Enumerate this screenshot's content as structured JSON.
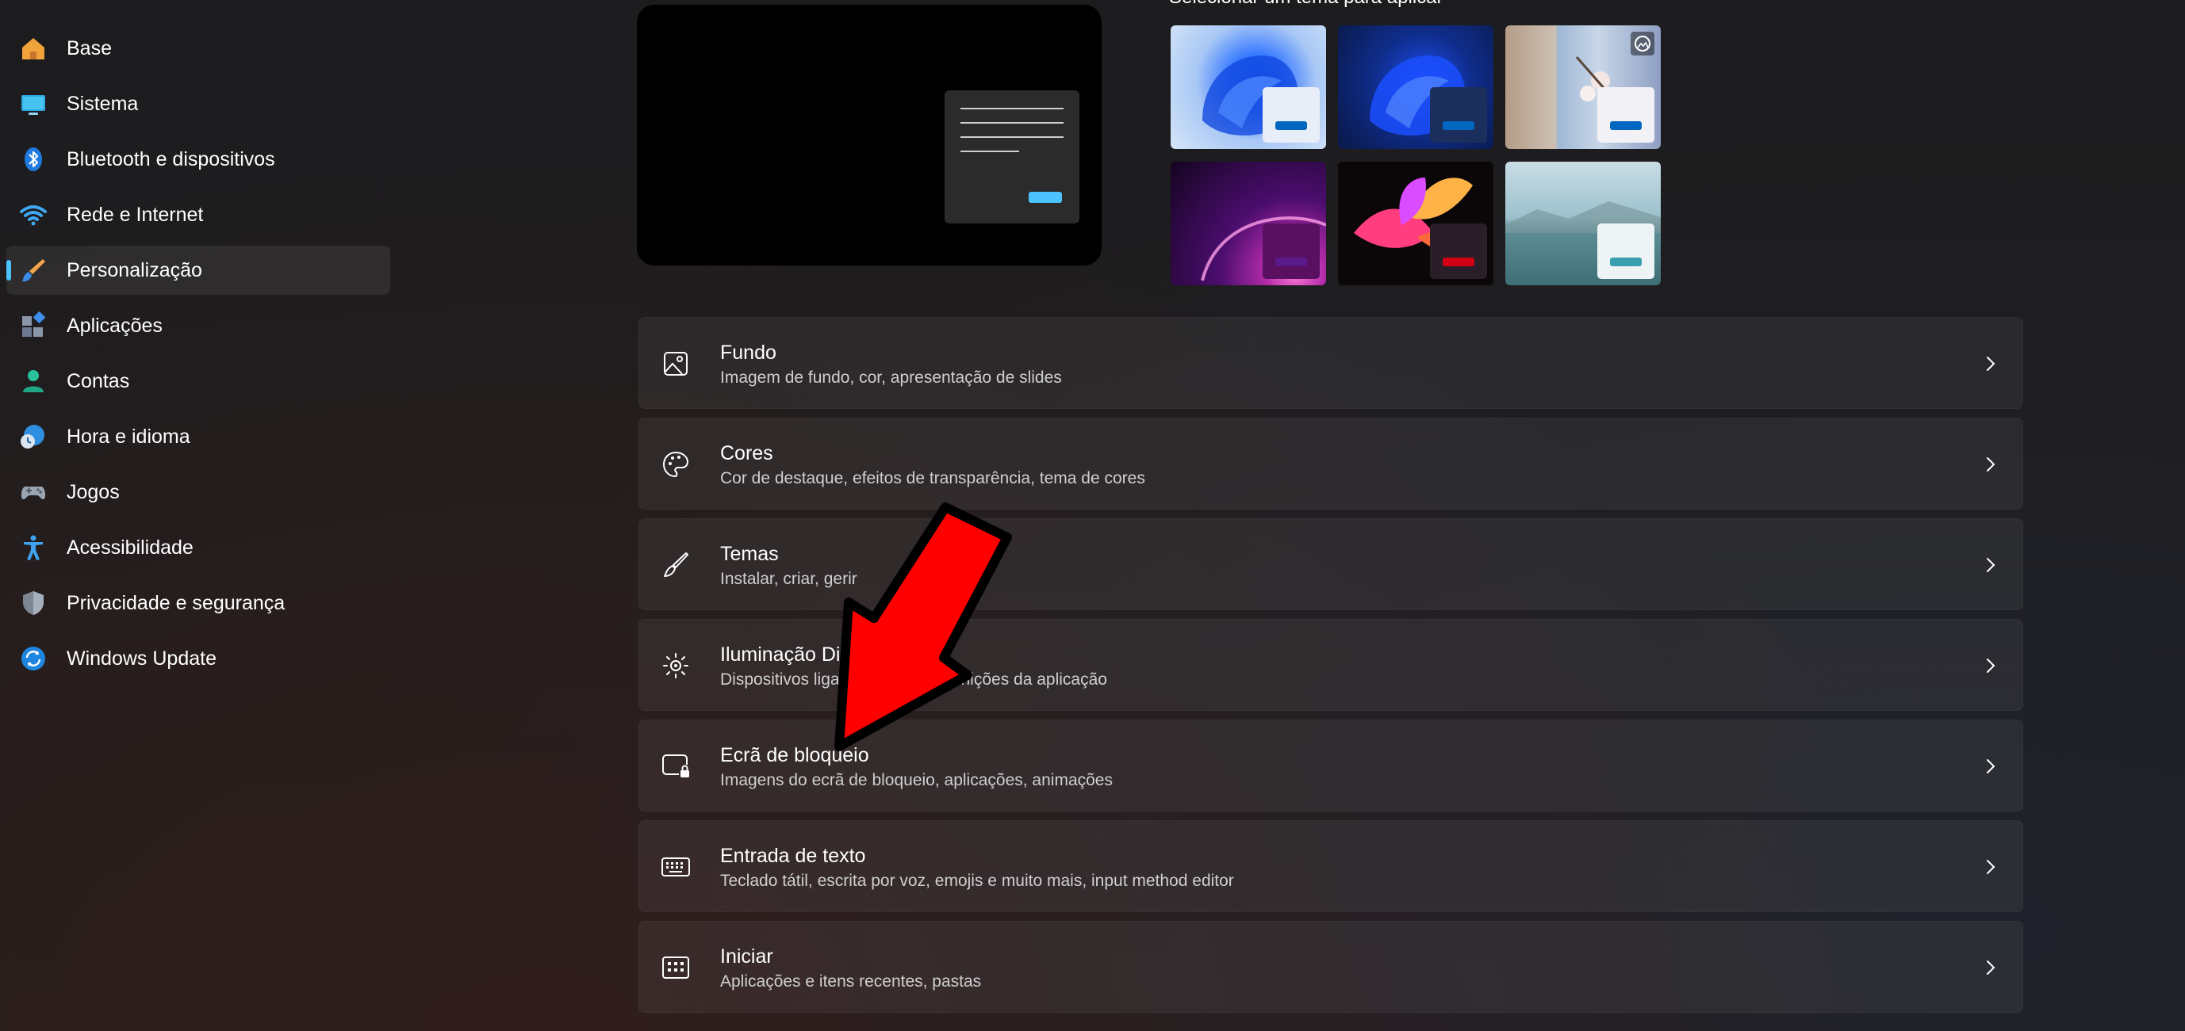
{
  "sidebar": {
    "items": [
      {
        "label": "Base",
        "icon": "home-icon",
        "selected": false
      },
      {
        "label": "Sistema",
        "icon": "system-monitor-icon",
        "selected": false
      },
      {
        "label": "Bluetooth e dispositivos",
        "icon": "bluetooth-icon",
        "selected": false
      },
      {
        "label": "Rede e Internet",
        "icon": "wifi-icon",
        "selected": false
      },
      {
        "label": "Personalização",
        "icon": "paintbrush-icon",
        "selected": true
      },
      {
        "label": "Aplicações",
        "icon": "apps-icon",
        "selected": false
      },
      {
        "label": "Contas",
        "icon": "account-icon",
        "selected": false
      },
      {
        "label": "Hora e idioma",
        "icon": "globe-clock-icon",
        "selected": false
      },
      {
        "label": "Jogos",
        "icon": "gamepad-icon",
        "selected": false
      },
      {
        "label": "Acessibilidade",
        "icon": "accessibility-icon",
        "selected": false
      },
      {
        "label": "Privacidade e segurança",
        "icon": "shield-icon",
        "selected": false
      },
      {
        "label": "Windows Update",
        "icon": "windows-update-icon",
        "selected": false
      }
    ]
  },
  "themes": {
    "heading": "Selecionar um tema para aplicar",
    "items": [
      {
        "name": "windows-light-bloom",
        "accent": "#0067c0",
        "swatch_bg": "#e8eef7",
        "selected": false
      },
      {
        "name": "windows-dark-bloom",
        "accent": "#0067c0",
        "swatch_bg": "#1c2f5c",
        "selected": false
      },
      {
        "name": "spring-blossom",
        "accent": "#0067c0",
        "swatch_bg": "#f2f2f6",
        "selected": true
      },
      {
        "name": "glow",
        "accent": "#5a1a8c",
        "swatch_bg": "#5a1060",
        "selected": false
      },
      {
        "name": "captured-motion",
        "accent": "#d10015",
        "swatch_bg": "#2a1e28",
        "selected": false
      },
      {
        "name": "flow",
        "accent": "#3aa0b0",
        "swatch_bg": "#eef3f5",
        "selected": false
      }
    ]
  },
  "cards": [
    {
      "title": "Fundo",
      "subtitle": "Imagem de fundo, cor, apresentação de slides",
      "icon": "image-icon"
    },
    {
      "title": "Cores",
      "subtitle": "Cor de destaque, efeitos de transparência, tema de cores",
      "icon": "palette-icon"
    },
    {
      "title": "Temas",
      "subtitle": "Instalar, criar, gerir",
      "icon": "brush-icon"
    },
    {
      "title": "Iluminação Dinâmica",
      "subtitle": "Dispositivos ligados, efeitos, definições da aplicação",
      "icon": "dynamic-lighting-icon"
    },
    {
      "title": "Ecrã de bloqueio",
      "subtitle": "Imagens do ecrã de bloqueio, aplicações, animações",
      "icon": "lock-screen-icon"
    },
    {
      "title": "Entrada de texto",
      "subtitle": "Teclado tátil, escrita por voz, emojis e muito mais, input method editor",
      "icon": "keyboard-icon"
    },
    {
      "title": "Iniciar",
      "subtitle": "Aplicações e itens recentes, pastas",
      "icon": "start-icon"
    }
  ],
  "colors": {
    "accent": "#4cc2ff",
    "annotation": "#ff0000"
  }
}
